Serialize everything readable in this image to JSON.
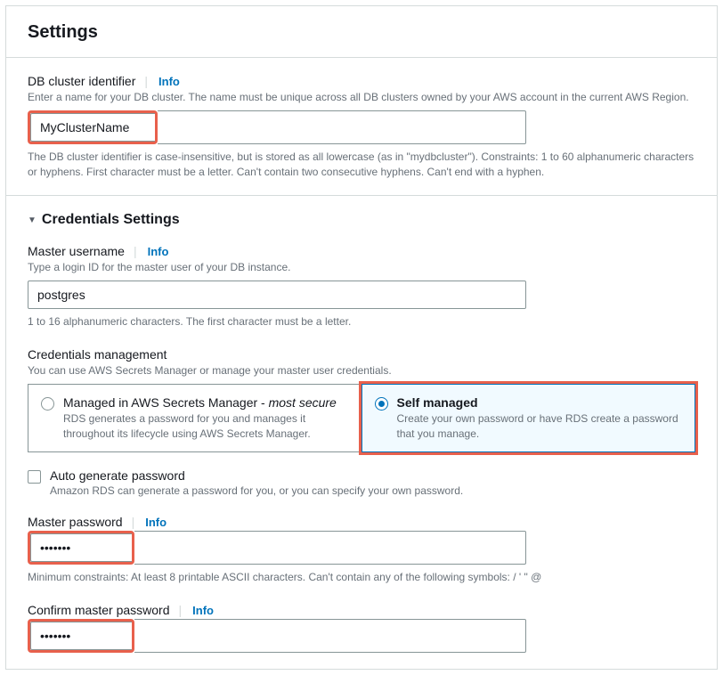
{
  "header": {
    "title": "Settings"
  },
  "clusterId": {
    "label": "DB cluster identifier",
    "info": "Info",
    "description": "Enter a name for your DB cluster. The name must be unique across all DB clusters owned by your AWS account in the current AWS Region.",
    "value": "MyClusterName",
    "help": "The DB cluster identifier is case-insensitive, but is stored as all lowercase (as in \"mydbcluster\"). Constraints: 1 to 60 alphanumeric characters or hyphens. First character must be a letter. Can't contain two consecutive hyphens. Can't end with a hyphen."
  },
  "credentials": {
    "sectionTitle": "Credentials Settings",
    "username": {
      "label": "Master username",
      "info": "Info",
      "description": "Type a login ID for the master user of your DB instance.",
      "value": "postgres",
      "help": "1 to 16 alphanumeric characters. The first character must be a letter."
    },
    "management": {
      "label": "Credentials management",
      "description": "You can use AWS Secrets Manager or manage your master user credentials.",
      "options": [
        {
          "title": "Managed in AWS Secrets Manager - ",
          "titleSuffix": "most secure",
          "desc": "RDS generates a password for you and manages it throughout its lifecycle using AWS Secrets Manager.",
          "selected": false
        },
        {
          "title": "Self managed",
          "desc": "Create your own password or have RDS create a password that you manage.",
          "selected": true
        }
      ]
    },
    "autoGenerate": {
      "label": "Auto generate password",
      "desc": "Amazon RDS can generate a password for you, or you can specify your own password.",
      "checked": false
    },
    "masterPassword": {
      "label": "Master password",
      "info": "Info",
      "value": "•••••••",
      "help": "Minimum constraints: At least 8 printable ASCII characters. Can't contain any of the following symbols: / ' \" @"
    },
    "confirmPassword": {
      "label": "Confirm master password",
      "info": "Info",
      "value": "•••••••"
    }
  }
}
